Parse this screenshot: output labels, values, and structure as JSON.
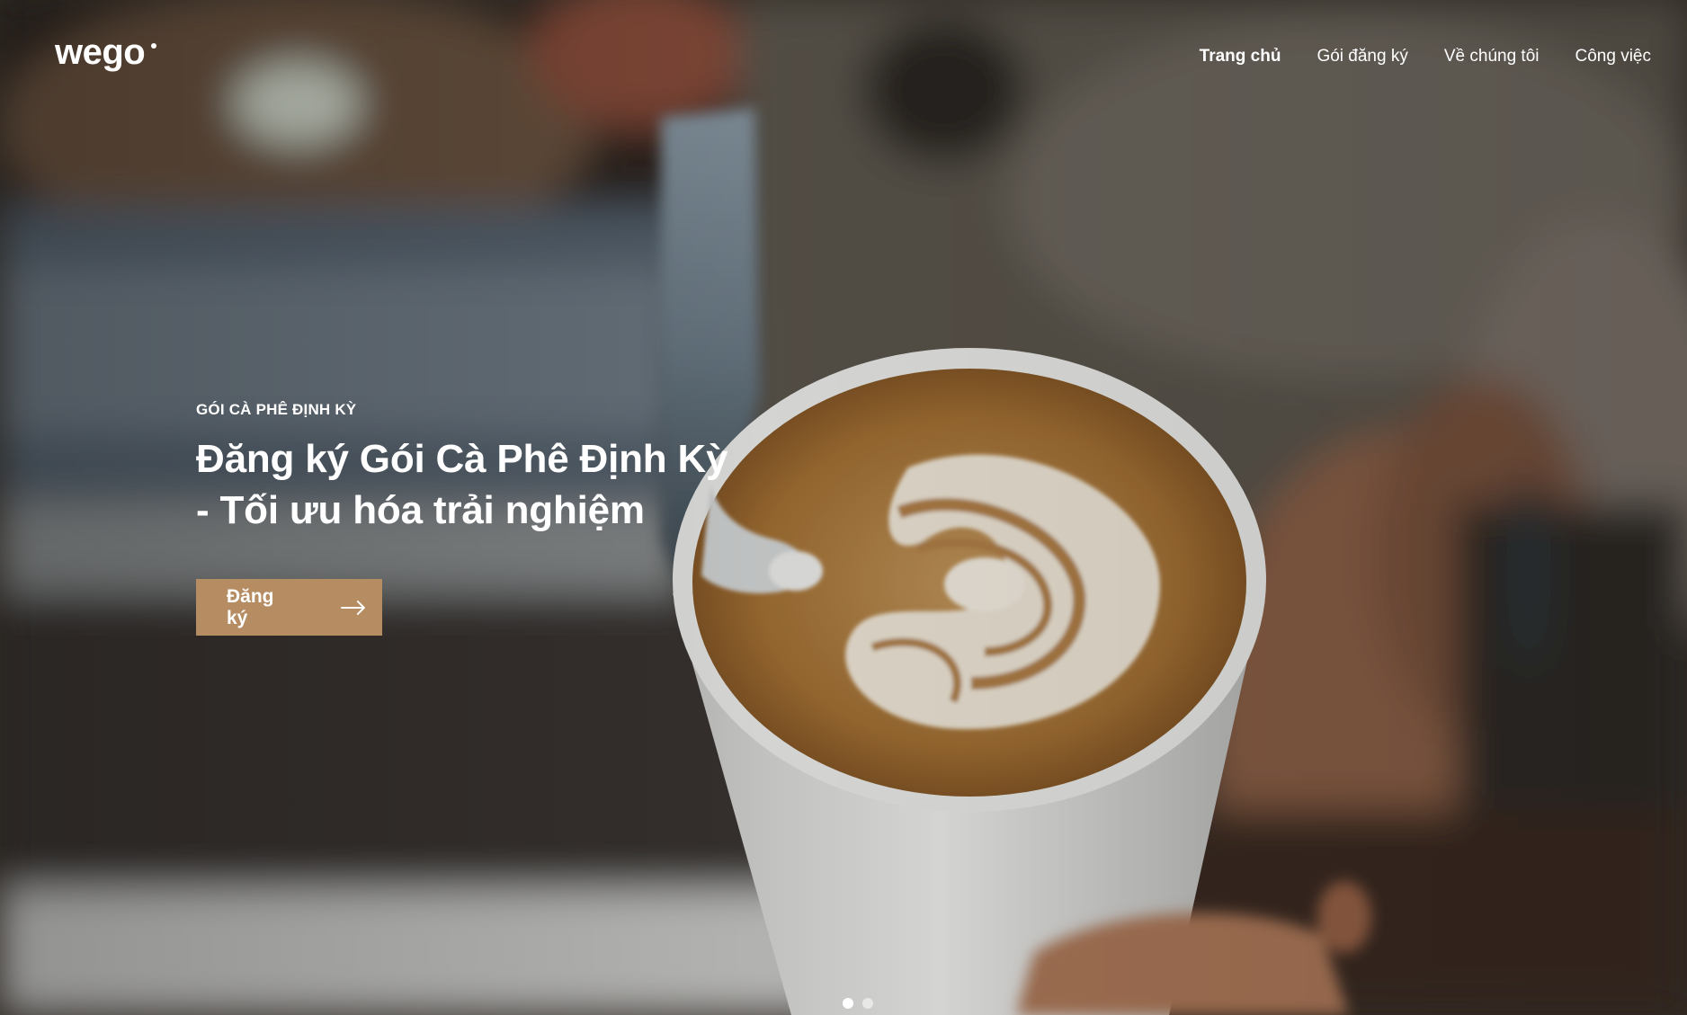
{
  "brand": {
    "logo_text": "wego",
    "accent_color": "#b68d62"
  },
  "nav": {
    "items": [
      {
        "label": "Trang chủ",
        "active": true
      },
      {
        "label": "Gói đăng ký",
        "active": false
      },
      {
        "label": "Về chúng tôi",
        "active": false
      },
      {
        "label": "Công việc",
        "active": false
      }
    ]
  },
  "hero": {
    "eyebrow": "GÓI CÀ PHÊ ĐỊNH KỲ",
    "headline_line1": "Đăng ký Gói Cà Phê Định Kỳ",
    "headline_line2": "- Tối ưu hóa trải nghiệm",
    "cta_label": "Đăng ký",
    "cta_icon": "arrow-right-icon",
    "background": "latte-art-pour-photo"
  },
  "slider": {
    "slide_count": 2,
    "active_index": 0
  }
}
